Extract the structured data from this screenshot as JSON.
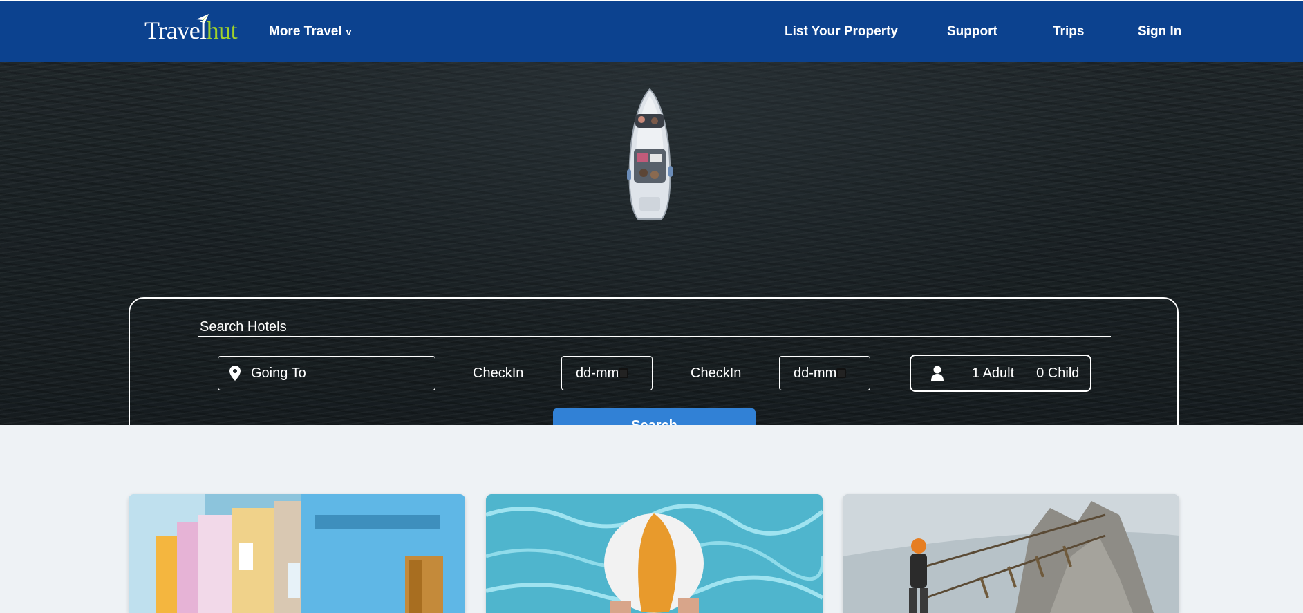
{
  "header": {
    "logo_part1": "Travel",
    "logo_part2": "hut",
    "more_travel": "More Travel",
    "more_travel_chevron": "v",
    "nav": [
      "List Your Property",
      "Support",
      "Trips",
      "Sign In"
    ]
  },
  "search": {
    "title": "Search Hotels",
    "destination_placeholder": "Going To",
    "checkin_label_1": "CheckIn",
    "checkin_date_1": "dd-mm",
    "checkin_label_2": "CheckIn",
    "checkin_date_2": "dd-mm",
    "adults": "1 Adult",
    "children": "0 Child",
    "button": "Search"
  },
  "cards": [
    {
      "icon": "colorful-houses-image"
    },
    {
      "icon": "beach-ball-pool-image"
    },
    {
      "icon": "rope-bridge-climber-image"
    }
  ],
  "colors": {
    "header_bg": "#0c428f",
    "logo_accent": "#9fd12b",
    "search_button": "#3181d6",
    "page_bg": "#eef2f5"
  }
}
